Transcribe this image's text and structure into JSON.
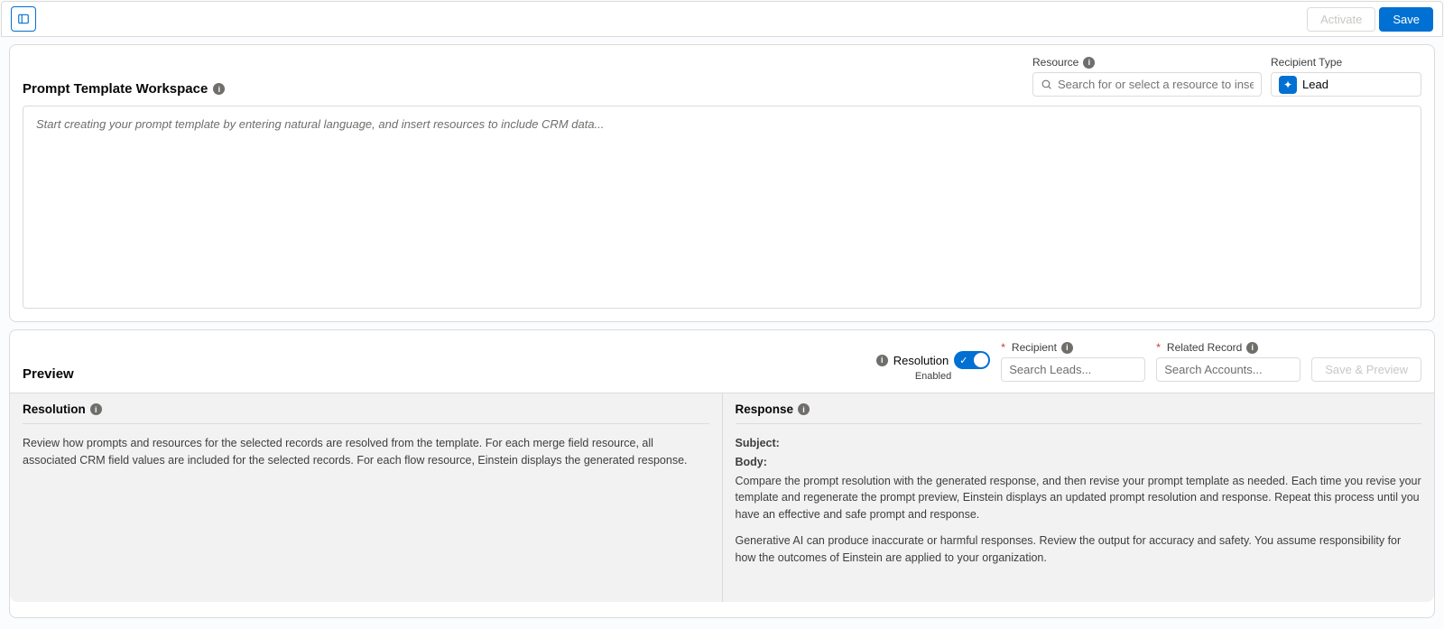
{
  "toolbar": {
    "activate_label": "Activate",
    "save_label": "Save"
  },
  "workspace": {
    "title": "Prompt Template Workspace",
    "resource_label": "Resource",
    "resource_placeholder": "Search for or select a resource to insert",
    "recipient_type_label": "Recipient Type",
    "recipient_type_value": "Lead",
    "editor_placeholder": "Start creating your prompt template by entering natural language, and insert resources to include CRM data..."
  },
  "preview": {
    "title": "Preview",
    "resolution_label": "Resolution",
    "toggle_state": "Enabled",
    "recipient_label": "Recipient",
    "recipient_placeholder": "Search Leads...",
    "related_record_label": "Related Record",
    "related_record_placeholder": "Search Accounts...",
    "save_preview_label": "Save & Preview"
  },
  "resolution": {
    "title": "Resolution",
    "body": "Review how prompts and resources for the selected records are resolved from the template. For each merge field resource, all associated CRM field values are included for the selected records. For each flow resource, Einstein displays the generated response."
  },
  "response": {
    "title": "Response",
    "subject_label": "Subject:",
    "body_label": "Body:",
    "body1": "Compare the prompt resolution with the generated response, and then revise your prompt template as needed. Each time you revise your template and regenerate the prompt preview, Einstein displays an updated prompt resolution and response. Repeat this process until you have an effective and safe prompt and response.",
    "body2": "Generative AI can produce inaccurate or harmful responses. Review the output for accuracy and safety. You assume responsibility for how the outcomes of Einstein are applied to your organization."
  }
}
